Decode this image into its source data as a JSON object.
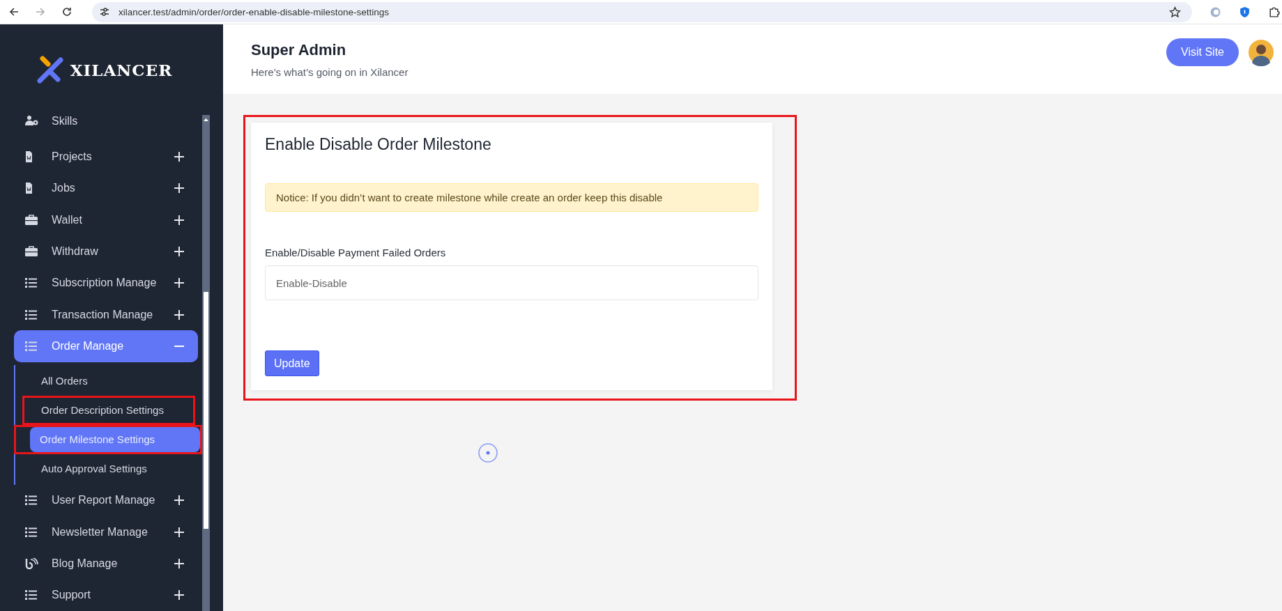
{
  "browser": {
    "url": "xilancer.test/admin/order/order-enable-disable-milestone-settings"
  },
  "sidebar": {
    "logo": "XILANCER",
    "items": [
      {
        "label": "Skills",
        "kind": "user",
        "expandable": false,
        "expanded": false
      },
      {
        "label": "Projects",
        "kind": "document",
        "expandable": true,
        "expanded": false
      },
      {
        "label": "Jobs",
        "kind": "document",
        "expandable": true,
        "expanded": false
      },
      {
        "label": "Wallet",
        "kind": "briefcase",
        "expandable": true,
        "expanded": false
      },
      {
        "label": "Withdraw",
        "kind": "briefcase",
        "expandable": true,
        "expanded": false
      },
      {
        "label": "Subscription Manage",
        "kind": "list",
        "expandable": true,
        "expanded": false
      },
      {
        "label": "Transaction Manage",
        "kind": "list",
        "expandable": true,
        "expanded": false
      },
      {
        "label": "Order Manage",
        "kind": "list",
        "expandable": true,
        "expanded": true,
        "children": [
          {
            "label": "All Orders",
            "selected": false,
            "highlighted": false
          },
          {
            "label": "Order Description Settings",
            "selected": false,
            "highlighted": true
          },
          {
            "label": "Order Milestone Settings",
            "selected": true,
            "highlighted": true
          },
          {
            "label": "Auto Approval Settings",
            "selected": false,
            "highlighted": false
          }
        ]
      },
      {
        "label": "User Report Manage",
        "kind": "list",
        "expandable": true,
        "expanded": false
      },
      {
        "label": "Newsletter Manage",
        "kind": "list",
        "expandable": true,
        "expanded": false
      },
      {
        "label": "Blog Manage",
        "kind": "feed",
        "expandable": true,
        "expanded": false
      },
      {
        "label": "Support",
        "kind": "list",
        "expandable": true,
        "expanded": false
      }
    ]
  },
  "header": {
    "title": "Super Admin",
    "subtitle": "Here’s what’s going on in Xilancer",
    "button": "Visit Site"
  },
  "card": {
    "title": "Enable Disable Order Milestone",
    "highlighted": true,
    "notice": "Notice: If you didn’t want to create milestone while create an order keep this disable",
    "field": {
      "label": "Enable/Disable Payment Failed Orders",
      "placeholder": "Enable-Disable"
    },
    "button": "Update"
  }
}
